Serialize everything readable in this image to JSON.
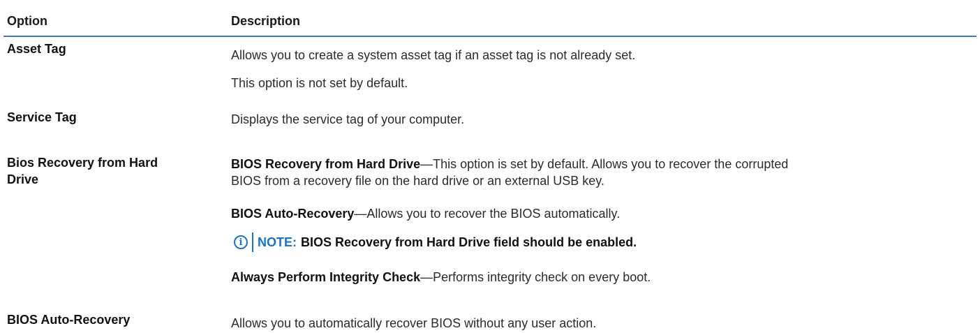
{
  "table": {
    "headers": {
      "option": "Option",
      "description": "Description"
    },
    "rows": [
      {
        "option": "Asset Tag",
        "descriptions": [
          "Allows you to create a system asset tag if an asset tag is not already set.",
          "This option is not set by default."
        ]
      },
      {
        "option": "Service Tag",
        "descriptions": [
          "Displays the service tag of your computer."
        ]
      },
      {
        "option_line1": "Bios Recovery from Hard",
        "option_line2": "Drive",
        "items": [
          {
            "bold": "BIOS Recovery from Hard Drive",
            "text_line1": "—This option is set by default. Allows you to recover the corrupted",
            "text_line2": "BIOS from a recovery file on the hard drive or an external USB key."
          },
          {
            "bold": "BIOS Auto-Recovery",
            "text": "—Allows you to recover the BIOS automatically."
          }
        ],
        "note": {
          "icon": "info-icon",
          "label": "NOTE:",
          "text": "BIOS Recovery from Hard Drive field should be enabled."
        },
        "item_after_note": {
          "bold": "Always Perform Integrity Check",
          "text": "—Performs integrity check on every boot."
        }
      },
      {
        "option": "BIOS Auto-Recovery",
        "descriptions": [
          "Allows you to automatically recover BIOS without any user action."
        ]
      }
    ]
  },
  "colors": {
    "accent": "#1a73c9",
    "header_rule": "#3f7ab6",
    "text": "#1f1f1f"
  }
}
